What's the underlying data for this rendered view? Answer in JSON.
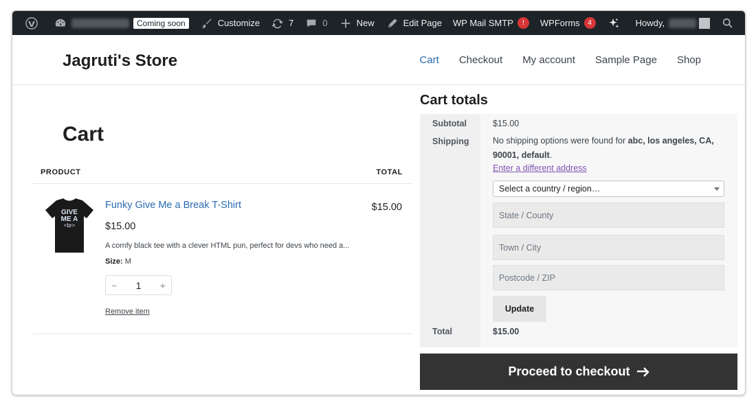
{
  "adminbar": {
    "coming_soon": "Coming soon",
    "customize": "Customize",
    "updates_count": "7",
    "comments_count": "0",
    "new": "New",
    "edit_page": "Edit Page",
    "wp_mail_smtp": "WP Mail SMTP",
    "wp_mail_smtp_badge": "!",
    "wpforms": "WPForms",
    "wpforms_badge": "4",
    "howdy": "Howdy,"
  },
  "site": {
    "title": "Jagruti's Store",
    "nav": [
      "Cart",
      "Checkout",
      "My account",
      "Sample Page",
      "Shop"
    ],
    "active_nav": "Cart"
  },
  "cart": {
    "title": "Cart",
    "col_product": "PRODUCT",
    "col_total": "TOTAL",
    "item": {
      "name": "Funky Give Me a Break T-Shirt",
      "price": "$15.00",
      "description": "A comfy black tee with a clever HTML pun, perfect for devs who need a...",
      "meta_label": "Size:",
      "meta_value": "M",
      "quantity": "1",
      "remove": "Remove item",
      "total": "$15.00",
      "shirt_text_line1": "GIVE",
      "shirt_text_line2": "ME A",
      "shirt_text_line3": "<br>"
    }
  },
  "totals": {
    "title": "Cart totals",
    "subtotal_label": "Subtotal",
    "subtotal_value": "$15.00",
    "shipping_label": "Shipping",
    "shipping_text_prefix": "No shipping options were found for ",
    "shipping_address": "abc, los angeles, CA, 90001, default",
    "shipping_text_suffix": ".",
    "different_address": "Enter a different address",
    "country_select": "Select a country / region…",
    "state_placeholder": "State / County",
    "city_placeholder": "Town / City",
    "postcode_placeholder": "Postcode / ZIP",
    "update_button": "Update",
    "total_label": "Total",
    "total_value": "$15.00",
    "checkout_button": "Proceed to checkout"
  },
  "colors": {
    "admin_bar": "#1d2327",
    "link": "#2a6ab0",
    "badge": "#d63638",
    "checkout": "#333333",
    "address_link": "#7f54b3"
  }
}
